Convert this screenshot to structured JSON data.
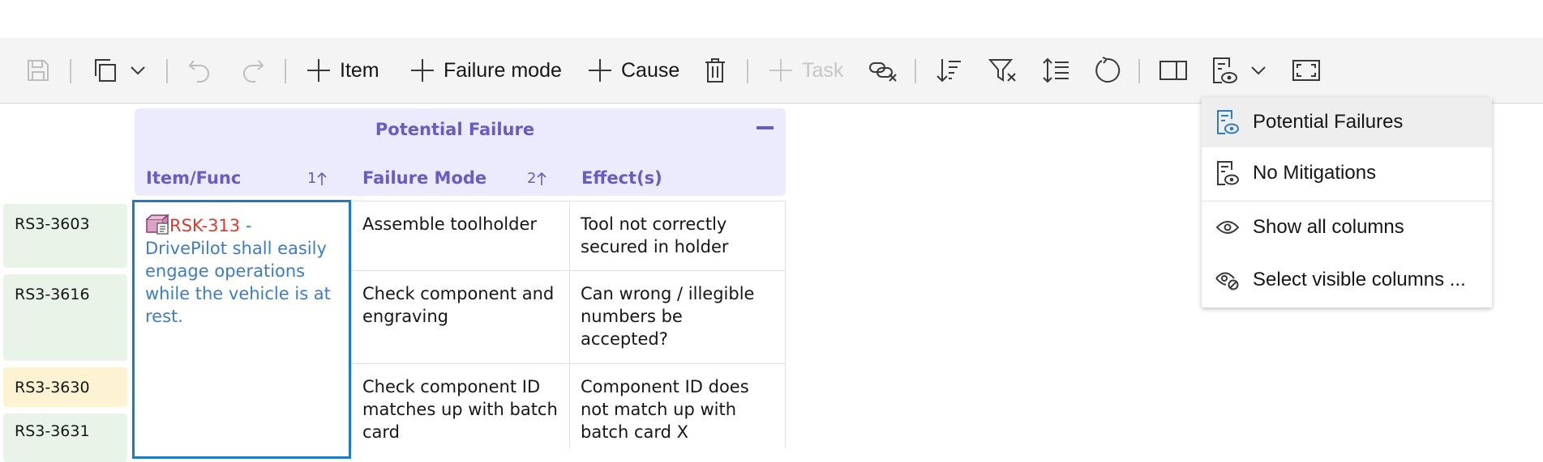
{
  "toolbar": {
    "item_label": "Item",
    "failure_mode_label": "Failure mode",
    "cause_label": "Cause",
    "task_label": "Task",
    "icons": [
      "save-icon",
      "copy-icon",
      "chevron-down-icon",
      "undo-icon",
      "redo-icon",
      "add-icon",
      "add-icon",
      "add-icon",
      "delete-icon",
      "add-icon",
      "unlink-icon",
      "sort-icon",
      "filter-clear-icon",
      "row-height-icon",
      "refresh-icon",
      "split-view-icon",
      "view-filter-icon",
      "chevron-down-icon",
      "fullscreen-icon"
    ]
  },
  "row_ids": [
    {
      "id": "RS3-3603",
      "status": "green"
    },
    {
      "id": "RS3-3616",
      "status": "green"
    },
    {
      "id": "RS3-3630",
      "status": "yellow"
    },
    {
      "id": "RS3-3631",
      "status": "green"
    }
  ],
  "header": {
    "group_title": "Potential Failure",
    "columns": [
      {
        "label": "Item/Func",
        "sort": "1"
      },
      {
        "label": "Failure Mode",
        "sort": "2"
      },
      {
        "label": "Effect(s)",
        "sort": ""
      }
    ]
  },
  "item": {
    "risk_id": "RSK-313",
    "separator": " -",
    "text_lines": [
      "DrivePilot shall easily",
      "engage operations",
      "while the vehicle is at",
      "rest."
    ]
  },
  "rows": [
    {
      "failure_mode": [
        "Assemble toolholder"
      ],
      "effect": [
        "Tool not correctly",
        "secured in holder"
      ]
    },
    {
      "failure_mode": [
        "Check component and",
        "engraving"
      ],
      "effect": [
        "Can wrong  / illegible",
        "numbers be",
        "accepted?"
      ]
    },
    {
      "failure_mode": [
        "Check component ID",
        "matches up with batch",
        "card"
      ],
      "effect": [
        "Component ID does",
        "not match up with",
        "batch card X"
      ]
    }
  ],
  "menu": {
    "items": [
      {
        "label": "Potential Failures",
        "icon": "view-filter-icon",
        "selected": true
      },
      {
        "label": "No Mitigations",
        "icon": "view-filter-icon",
        "selected": false
      },
      {
        "label": "Show all columns",
        "icon": "eye-icon",
        "selected": false
      },
      {
        "label": "Select visible columns ...",
        "icon": "view-settings-icon",
        "selected": false
      }
    ]
  },
  "colors": {
    "accent": "#6a5bc2",
    "header_bg": "#ecebfd",
    "link": "#3b7dc4",
    "risk": "#da3b2f",
    "selection_border": "#1f7ac4",
    "status_green": "#e9f4e8",
    "status_yellow": "#fdf2d2"
  }
}
